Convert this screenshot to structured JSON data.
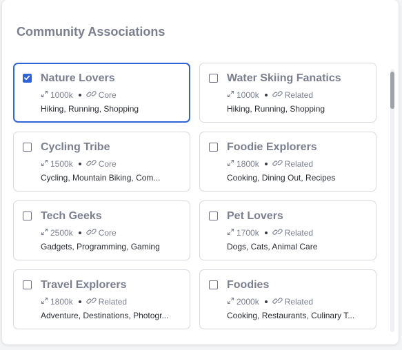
{
  "panel": {
    "title": "Community Associations"
  },
  "cards": [
    {
      "name": "Nature Lovers",
      "size": "1000k",
      "relation": "Core",
      "tags": "Hiking, Running, Shopping",
      "checked": true
    },
    {
      "name": "Water Skiing Fanatics",
      "size": "1000k",
      "relation": "Related",
      "tags": "Hiking, Running, Shopping",
      "checked": false
    },
    {
      "name": "Cycling Tribe",
      "size": "1500k",
      "relation": "Core",
      "tags": "Cycling, Mountain Biking, Com...",
      "checked": false
    },
    {
      "name": "Foodie Explorers",
      "size": "1800k",
      "relation": "Related",
      "tags": "Cooking, Dining Out, Recipes",
      "checked": false
    },
    {
      "name": "Tech Geeks",
      "size": "2500k",
      "relation": "Core",
      "tags": "Gadgets, Programming, Gaming",
      "checked": false
    },
    {
      "name": "Pet Lovers",
      "size": "1700k",
      "relation": "Related",
      "tags": "Dogs, Cats, Animal Care",
      "checked": false
    },
    {
      "name": "Travel Explorers",
      "size": "1800k",
      "relation": "Related",
      "tags": "Adventure, Destinations, Photogr...",
      "checked": false
    },
    {
      "name": "Foodies",
      "size": "2000k",
      "relation": "Related",
      "tags": "Cooking, Restaurants, Culinary T...",
      "checked": false
    }
  ],
  "icons": {
    "size": "expand-arrows-icon",
    "relation": "link-icon",
    "checkbox": "checkmark-icon"
  },
  "colors": {
    "accent": "#2f64d6",
    "muted_text": "#7b7f8e",
    "body_text": "#2a2d33",
    "border": "#d7d9de"
  }
}
